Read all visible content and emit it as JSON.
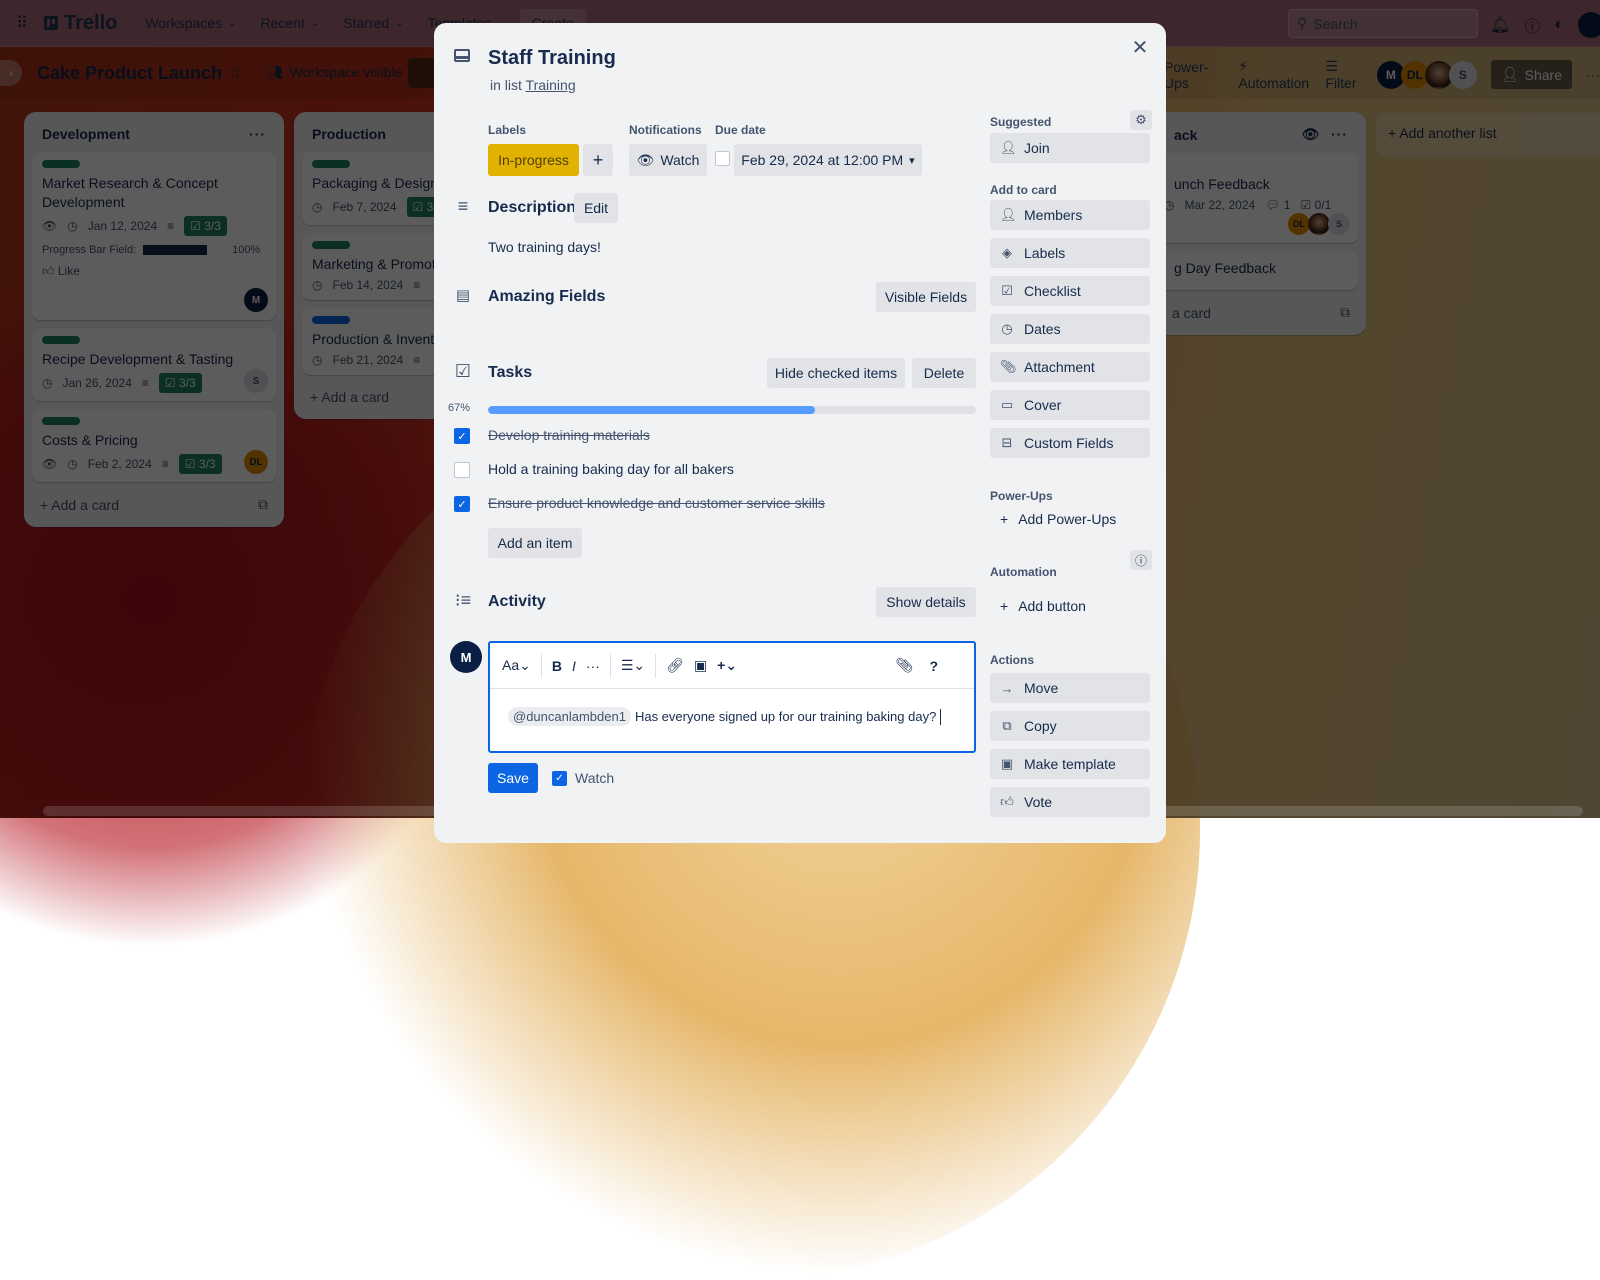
{
  "topnav": {
    "app_name": "Trello",
    "menus": [
      {
        "label": "Workspaces"
      },
      {
        "label": "Recent"
      },
      {
        "label": "Starred"
      },
      {
        "label": "Templates"
      }
    ],
    "create_label": "Create",
    "search_placeholder": "Search"
  },
  "board": {
    "title": "Cake Product Launch",
    "visibility": "Workspace visible",
    "power_ups_label": "Power-Ups",
    "automation_label": "Automation",
    "filter_label": "Filter",
    "share_label": "Share",
    "members": [
      {
        "initials": "M",
        "color": "#0b1f45"
      },
      {
        "initials": "DL",
        "color": "#e38f00"
      },
      {
        "initials": "",
        "color": "photo"
      },
      {
        "initials": "S",
        "color": "#dfe1e6"
      }
    ],
    "add_list_label": "Add another list"
  },
  "lists": [
    {
      "title": "Development",
      "cards": [
        {
          "title": "Market Research & Concept Development",
          "label_color": "#1f845a",
          "watching": true,
          "due": "Jan 12, 2024",
          "has_description": true,
          "checklist": "3/3",
          "progress_field_label": "Progress Bar Field:",
          "progress_field_value": "100%",
          "progress_fraction": 1.0,
          "like_label": "Like",
          "member": "M"
        },
        {
          "title": "Recipe Development & Tasting",
          "label_color": "#1f845a",
          "due": "Jan 26, 2024",
          "has_description": true,
          "checklist": "3/3",
          "member": "S"
        },
        {
          "title": "Costs & Pricing",
          "label_color": "#1f845a",
          "watching": true,
          "due": "Feb 2, 2024",
          "has_description": true,
          "checklist": "3/3",
          "member": "DL"
        }
      ],
      "add_card_label": "Add a card"
    },
    {
      "title": "Production",
      "cards": [
        {
          "title": "Packaging & Design",
          "label_color": "#1f845a",
          "due": "Feb 7, 2024",
          "checklist": "3/"
        },
        {
          "title": "Marketing & Promot",
          "label_color": "#1f845a",
          "due": "Feb 14, 2024",
          "has_description": true
        },
        {
          "title": "Production & Invent",
          "label_color": "#0c66e4",
          "due": "Feb 21, 2024",
          "has_description": true
        }
      ],
      "add_card_label": "Add a card"
    },
    {
      "title": "ack",
      "cards": [
        {
          "title": "unch Feedback",
          "due": "Mar 22, 2024",
          "comments": "1",
          "checklist": "0/1",
          "members": [
            "DL",
            "photo",
            "S"
          ]
        },
        {
          "title": "g Day Feedback"
        }
      ],
      "add_card_label": "a card"
    }
  ],
  "modal": {
    "title": "Staff Training",
    "in_list_prefix": "in list",
    "list_name": "Training",
    "labels_heading": "Labels",
    "label_name": "In-progress",
    "label_color": "#e2b203",
    "notifications_heading": "Notifications",
    "watch_label": "Watch",
    "due_heading": "Due date",
    "due_value": "Feb 29, 2024 at 12:00 PM",
    "description_heading": "Description",
    "edit_label": "Edit",
    "description_text": "Two training days!",
    "fields_heading": "Amazing Fields",
    "visible_fields_label": "Visible Fields",
    "checklist": {
      "heading": "Tasks",
      "hide_checked_label": "Hide checked items",
      "delete_label": "Delete",
      "percent_label": "67%",
      "progress": 0.67,
      "items": [
        {
          "text": "Develop training materials",
          "checked": true
        },
        {
          "text": "Hold a training baking day for all bakers",
          "checked": false
        },
        {
          "text": "Ensure product knowledge and customer service skills",
          "checked": true
        }
      ],
      "add_item_label": "Add an item"
    },
    "activity": {
      "heading": "Activity",
      "show_details_label": "Show details",
      "user_initial": "M",
      "toolbar": {
        "text_style": "Aa",
        "bold": "B",
        "italic": "I",
        "more": "···",
        "help": "?"
      },
      "mention": "@duncanlambden1",
      "comment_text": "Has everyone signed up for our training baking day?",
      "save_label": "Save",
      "watch_label": "Watch",
      "watch_checked": true
    },
    "sidebar": {
      "suggested_heading": "Suggested",
      "join_label": "Join",
      "add_to_card_heading": "Add to card",
      "add_to_card": [
        {
          "label": "Members",
          "icon": "person-icon"
        },
        {
          "label": "Labels",
          "icon": "tag-icon"
        },
        {
          "label": "Checklist",
          "icon": "checklist-icon"
        },
        {
          "label": "Dates",
          "icon": "clock-icon"
        },
        {
          "label": "Attachment",
          "icon": "paperclip-icon"
        },
        {
          "label": "Cover",
          "icon": "cover-icon"
        },
        {
          "label": "Custom Fields",
          "icon": "custom-fields-icon"
        }
      ],
      "power_ups_heading": "Power-Ups",
      "add_power_ups_label": "Add Power-Ups",
      "automation_heading": "Automation",
      "add_button_label": "Add button",
      "actions_heading": "Actions",
      "actions": [
        {
          "label": "Move",
          "icon": "arrow-right-icon"
        },
        {
          "label": "Copy",
          "icon": "copy-icon"
        },
        {
          "label": "Make template",
          "icon": "template-icon"
        },
        {
          "label": "Vote",
          "icon": "thumbs-up-icon"
        }
      ]
    }
  }
}
